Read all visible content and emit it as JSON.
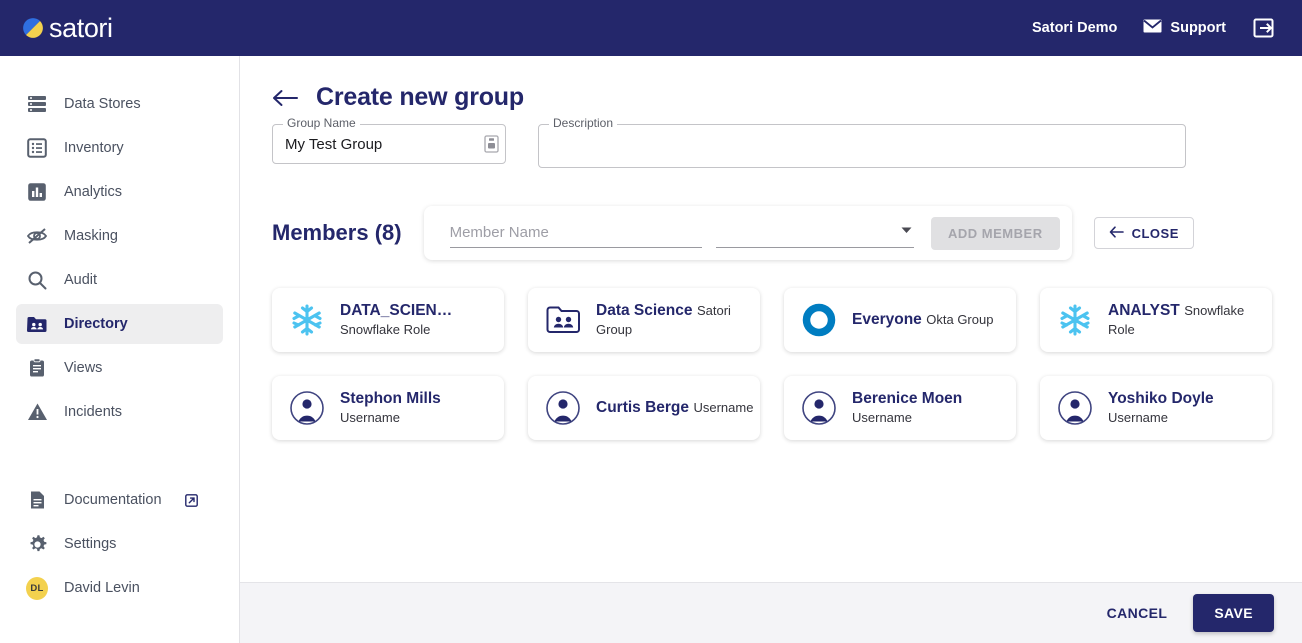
{
  "header": {
    "brand": "satori",
    "account": "Satori Demo",
    "support": "Support",
    "support_icon": "mail-icon",
    "logout_icon": "logout-icon",
    "logo_icon": "satori-logo-icon",
    "background": "#24276b"
  },
  "sidebar": {
    "items": [
      {
        "label": "Data Stores",
        "icon": "data-stores-icon",
        "active": false
      },
      {
        "label": "Inventory",
        "icon": "inventory-icon",
        "active": false
      },
      {
        "label": "Analytics",
        "icon": "analytics-icon",
        "active": false
      },
      {
        "label": "Masking",
        "icon": "masking-icon",
        "active": false
      },
      {
        "label": "Audit",
        "icon": "audit-icon",
        "active": false
      },
      {
        "label": "Directory",
        "icon": "directory-icon",
        "active": true
      },
      {
        "label": "Views",
        "icon": "views-icon",
        "active": false
      },
      {
        "label": "Incidents",
        "icon": "incidents-icon",
        "active": false
      }
    ],
    "bottom_items": [
      {
        "label": "Documentation",
        "icon": "document-icon",
        "external": true
      },
      {
        "label": "Settings",
        "icon": "gear-icon",
        "external": false
      }
    ],
    "user": {
      "initials": "DL",
      "name": "David Levin",
      "avatar_color": "#f3d14e"
    }
  },
  "page": {
    "title": "Create new group",
    "back_icon": "arrow-left-icon"
  },
  "form": {
    "group_name": {
      "label": "Group Name",
      "value": "My Test Group",
      "placeholder": "",
      "icon": "clipboard-icon"
    },
    "description": {
      "label": "Description",
      "value": "",
      "placeholder": ""
    }
  },
  "members_section": {
    "title": "Members (8)",
    "member_name_placeholder": "Member Name",
    "member_name_value": "",
    "type_select_value": "",
    "type_select_icon": "chevron-down-icon",
    "add_member_label": "ADD MEMBER",
    "add_member_disabled": true,
    "close_label": "CLOSE",
    "close_icon": "arrow-left-icon"
  },
  "members": [
    {
      "name": "DATA_SCIEN…",
      "type": "Snowflake Role",
      "icon": "snowflake-icon",
      "icon_color": "#4cc3f0"
    },
    {
      "name": "Data Science",
      "type": "Satori Group",
      "icon": "satori-group-icon",
      "icon_color": "#24276b"
    },
    {
      "name": "Everyone",
      "type": "Okta Group",
      "icon": "okta-icon",
      "icon_color": "#007dc1"
    },
    {
      "name": "ANALYST",
      "type": "Snowflake Role",
      "icon": "snowflake-icon",
      "icon_color": "#4cc3f0"
    },
    {
      "name": "Stephon Mills",
      "type": "Username",
      "icon": "user-avatar-icon",
      "icon_color": "#24276b"
    },
    {
      "name": "Curtis Berge",
      "type": "Username",
      "icon": "user-avatar-icon",
      "icon_color": "#24276b"
    },
    {
      "name": "Berenice Moen",
      "type": "Username",
      "icon": "user-avatar-icon",
      "icon_color": "#24276b"
    },
    {
      "name": "Yoshiko Doyle",
      "type": "Username",
      "icon": "user-avatar-icon",
      "icon_color": "#24276b"
    }
  ],
  "footer": {
    "cancel_label": "CANCEL",
    "save_label": "SAVE",
    "save_color": "#24276b"
  }
}
